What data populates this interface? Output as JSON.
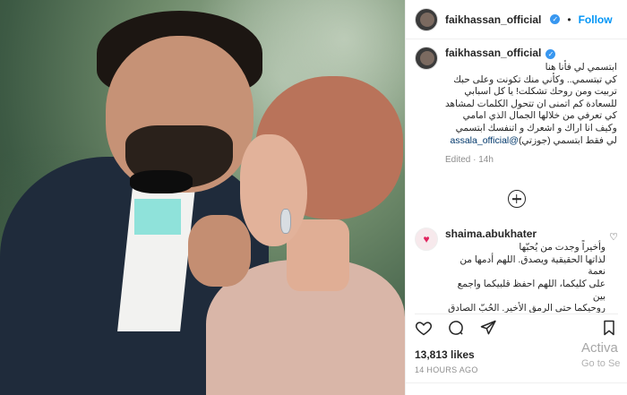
{
  "header": {
    "username": "faikhassan_official",
    "follow_label": "Follow",
    "dot": "•"
  },
  "caption": {
    "username": "faikhassan_official",
    "text": "ابتسمي لي فأنا هنا\nكي تبتسمي.. وكأني منك تكونت وعلى حبك\nتربيت ومن روحك تشكلت! يا كل اسبابي\nللسعادة كم اتمنى ان تتحول الكلمات لمشاهد\nكي تعرفي من خلالها الجمال الذي امامي\nوكيف انا اراك و اشعرك و اتنفسك ابتسمي",
    "mention": "@assala_official",
    "text_end": " لي فقط ابتسمي (جوزتي)",
    "edited": "Edited",
    "age": "14h"
  },
  "comment": {
    "username": "shaima.abukhater",
    "text": "وأخيراً وجدت من يُحبّها\nلذاتها الحقيقية ويصدق. اللهم أدمها من نعمة\nعلى كليكما، اللهم احفظ قلبيكما واجمع بين\nروحيكما حتى الرمق الأخير. الحُبّ الصادق\nصوتُه عالٍ جداً حتى لو عجزت الكلمات عن\nوصفه.",
    "hearts": "❤❤❤❤❤"
  },
  "stats": {
    "likes": "13,813 likes",
    "time": "14 HOURS AGO"
  },
  "watermark": {
    "line1": "Activa",
    "line2": "Go to Se"
  },
  "icons": [
    "verified-badge-icon",
    "add-comments-icon",
    "heart-icon",
    "comment-icon",
    "share-icon",
    "bookmark-icon"
  ],
  "colors": {
    "link": "#0095f6",
    "verified": "#3897f0",
    "heart": "#ed4956"
  }
}
